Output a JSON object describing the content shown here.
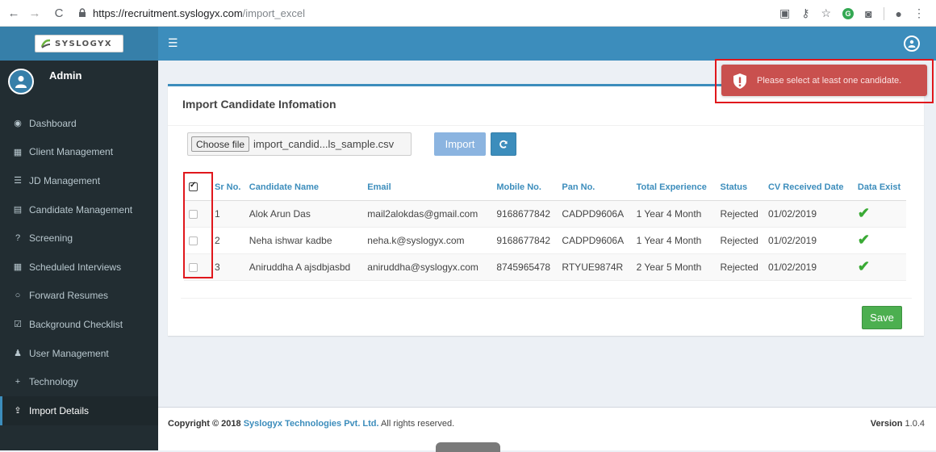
{
  "browser": {
    "url_host": "https://recruitment.syslogyx.com",
    "url_path": "/import_excel"
  },
  "brand": {
    "logo_text": "SYSLOGYX"
  },
  "user": {
    "name": "Admin"
  },
  "sidebar": {
    "items": [
      {
        "label": "Dashboard",
        "icon": "dashboard-icon",
        "glyph": "◉"
      },
      {
        "label": "Client Management",
        "icon": "bank-icon",
        "glyph": "▦"
      },
      {
        "label": "JD Management",
        "icon": "list-icon",
        "glyph": "☰"
      },
      {
        "label": "Candidate Management",
        "icon": "file-icon",
        "glyph": "▤"
      },
      {
        "label": "Screening",
        "icon": "question-icon",
        "glyph": "?"
      },
      {
        "label": "Scheduled Interviews",
        "icon": "calendar-icon",
        "glyph": "▦"
      },
      {
        "label": "Forward Resumes",
        "icon": "circle-icon",
        "glyph": "○"
      },
      {
        "label": "Background Checklist",
        "icon": "checkbox-icon",
        "glyph": "☑"
      },
      {
        "label": "User Management",
        "icon": "user-plus-icon",
        "glyph": "♟"
      },
      {
        "label": "Technology",
        "icon": "plus-icon",
        "glyph": "+"
      },
      {
        "label": "Import Details",
        "icon": "upload-icon",
        "glyph": "⇪",
        "active": true
      }
    ]
  },
  "main": {
    "title": "Import Candidate Infomation",
    "file": {
      "button_label": "Choose file",
      "file_name": "import_candid...ls_sample.csv"
    },
    "import_label": "Import",
    "save_label": "Save",
    "table": {
      "columns": [
        "Sr No.",
        "Candidate Name",
        "Email",
        "Mobile No.",
        "Pan No.",
        "Total Experience",
        "Status",
        "CV Received Date",
        "Data Exist"
      ],
      "header_checked": true,
      "rows": [
        {
          "sr": "1",
          "name": "Alok Arun Das",
          "email": "mail2alokdas@gmail.com",
          "mobile": "9168677842",
          "pan": "CADPD9606A",
          "experience": "1 Year 4 Month",
          "status": "Rejected",
          "cv_date": "01/02/2019",
          "data_exist": "✔",
          "checked": false
        },
        {
          "sr": "2",
          "name": "Neha ishwar kadbe",
          "email": "neha.k@syslogyx.com",
          "mobile": "9168677842",
          "pan": "CADPD9606A",
          "experience": "1 Year 4 Month",
          "status": "Rejected",
          "cv_date": "01/02/2019",
          "data_exist": "✔",
          "checked": false
        },
        {
          "sr": "3",
          "name": "Aniruddha A ajsdbjasbd",
          "email": "aniruddha@syslogyx.com",
          "mobile": "8745965478",
          "pan": "RTYUE9874R",
          "experience": "2 Year 5 Month",
          "status": "Rejected",
          "cv_date": "01/02/2019",
          "data_exist": "✔",
          "checked": false
        }
      ]
    }
  },
  "alert": {
    "message": "Please select at least one candidate.",
    "color": "#c9504e"
  },
  "footer": {
    "copyright_prefix": "Copyright © 2018",
    "company": "Syslogyx Technologies Pvt. Ltd.",
    "rights": "All rights reserved.",
    "version_label": "Version",
    "version_value": "1.0.4"
  },
  "colors": {
    "primary": "#3c8dbc",
    "sidebar": "#222d32",
    "success": "#4caf50",
    "danger": "#c9504e"
  }
}
